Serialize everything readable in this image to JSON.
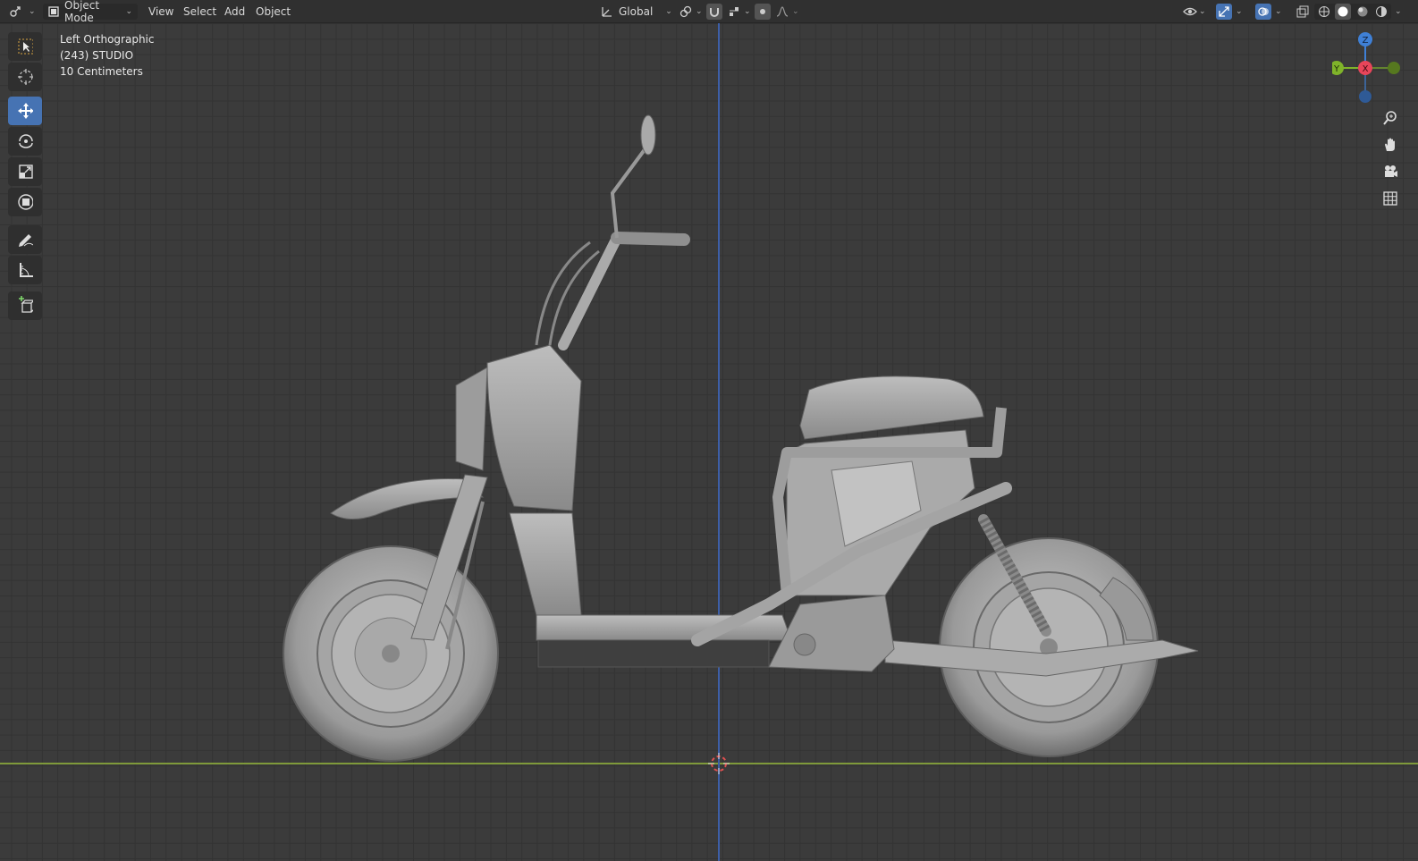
{
  "header": {
    "mode_label": "Object Mode",
    "menus": [
      "View",
      "Select",
      "Add",
      "Object"
    ],
    "transform_orientation": "Global"
  },
  "viewport_info": {
    "view_name": "Left Orthographic",
    "collection": "(243) STUDIO",
    "scale": "10 Centimeters"
  },
  "gizmo": {
    "z_label": "Z",
    "y_label": "Y",
    "x_label": "X",
    "colors": {
      "x": "#e8455a",
      "y": "#7fb32a",
      "z": "#3f80d6"
    }
  },
  "accent_color": "#4673b3",
  "scene": {
    "object": "electric scooter",
    "shading": "solid"
  }
}
